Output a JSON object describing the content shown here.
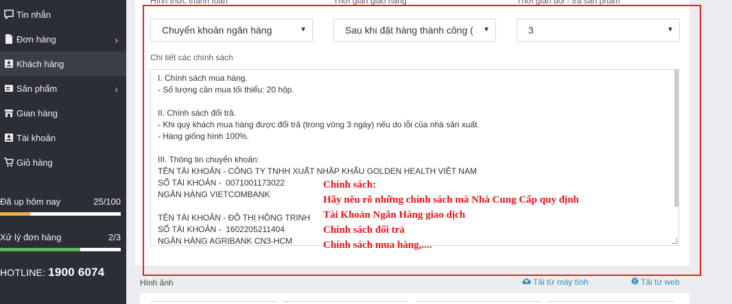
{
  "sidebar": {
    "items": [
      {
        "label": "Tin nhắn",
        "icon": "chat-icon",
        "has_submenu": false,
        "active": false
      },
      {
        "label": "Đơn hàng",
        "icon": "file-icon",
        "has_submenu": true,
        "active": false
      },
      {
        "label": "Khách hàng",
        "icon": "contact-card-icon",
        "has_submenu": false,
        "active": true
      },
      {
        "label": "Sản phẩm",
        "icon": "product-icon",
        "has_submenu": true,
        "active": false
      },
      {
        "label": "Gian hàng",
        "icon": "store-icon",
        "has_submenu": false,
        "active": false
      },
      {
        "label": "Tài khoản",
        "icon": "user-icon",
        "has_submenu": false,
        "active": false
      },
      {
        "label": "Giỏ hàng",
        "icon": "cart-icon",
        "has_submenu": false,
        "active": false
      }
    ],
    "stats": [
      {
        "label": "Đã up hôm nay",
        "value": "25/100",
        "fraction": 0.25,
        "color": "#f0ad4e"
      },
      {
        "label": "Xử lý đơn hàng",
        "value": "2/3",
        "fraction": 0.667,
        "color": "#5cb85c"
      }
    ],
    "hotline_label": "HOTLINE:",
    "hotline_number": "1900 6074"
  },
  "form": {
    "fields": [
      {
        "label": "Hình thức thanh toán",
        "value": "Chuyển khoản ngân hàng"
      },
      {
        "label": "Thời gian giao hàng",
        "value": "Sau khi đặt hàng thành công ("
      },
      {
        "label": "Thời gian đổi - trả sản phẩm",
        "value": "3"
      }
    ],
    "policy_label": "Chi tiết các chính sách",
    "policy_lines": [
      "I. Chính sách mua hàng.",
      "- Số lượng cần mua tối thiểu: 20 hộp.",
      "",
      "II. Chính sách đổi trả.",
      "- Khi quý khách mua hàng được đổi trả (trong vòng 3 ngày) nếu do lỗi của nhà sản xuất.",
      "- Hàng giống hình 100%.",
      "",
      "III. Thông tin chuyển khoản:",
      "TÊN TÀI KHOẢN - CÔNG TY TNHH XUẤT NHẬP KHẨU GOLDEN HEALTH VIỆT NAM",
      "SỐ TÀI KHOẢN -  0071001173022",
      "NGÂN HÀNG VIETCOMBANK",
      "",
      "TÊN TÀI KHOẢN - ĐỖ THỊ HỒNG TRINH",
      "SỐ TÀI KHOẢN -  1602205211404",
      "NGÂN HÀNG AGRIBANK CN3-HCM"
    ],
    "annotation_lines": [
      "Chính sách:",
      "Hãy nêu rõ những chính sách mà Nhà Cung Cấp quy định",
      "Tài Khoản Ngân Hàng giao dịch",
      "Chính sách đổi trả",
      "Chính sách mua hàng,...."
    ]
  },
  "images": {
    "label": "Hình ảnh",
    "upload_computer": "Tải từ máy tính",
    "upload_web": "Tải từ web"
  },
  "colors": {
    "sidebar_bg": "#2b2e37",
    "highlight_border": "#e31e24",
    "annotation_text": "#e3141b",
    "link": "#3c8dbc"
  }
}
